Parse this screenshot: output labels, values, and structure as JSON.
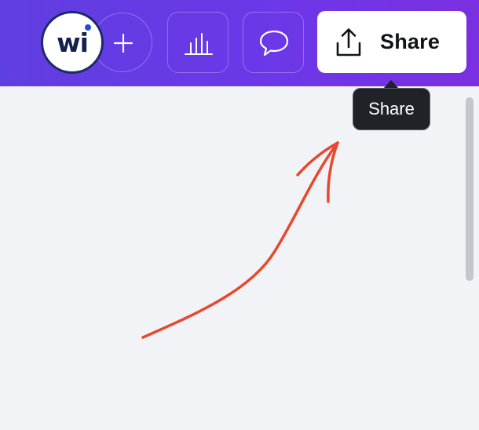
{
  "header": {
    "avatar_initials": "wi",
    "add_icon": "plus-icon",
    "insights_icon": "bar-chart-icon",
    "comments_icon": "speech-bubble-icon",
    "share": {
      "label": "Share",
      "icon": "upload-share-icon"
    }
  },
  "tooltip": {
    "text": "Share"
  },
  "colors": {
    "topbar_gradient_start": "#5f3ee0",
    "topbar_gradient_end": "#7a2fe0",
    "canvas_background": "#f2f3f7",
    "annotation_arrow": "#e8472b",
    "tooltip_background": "#1f2226"
  }
}
